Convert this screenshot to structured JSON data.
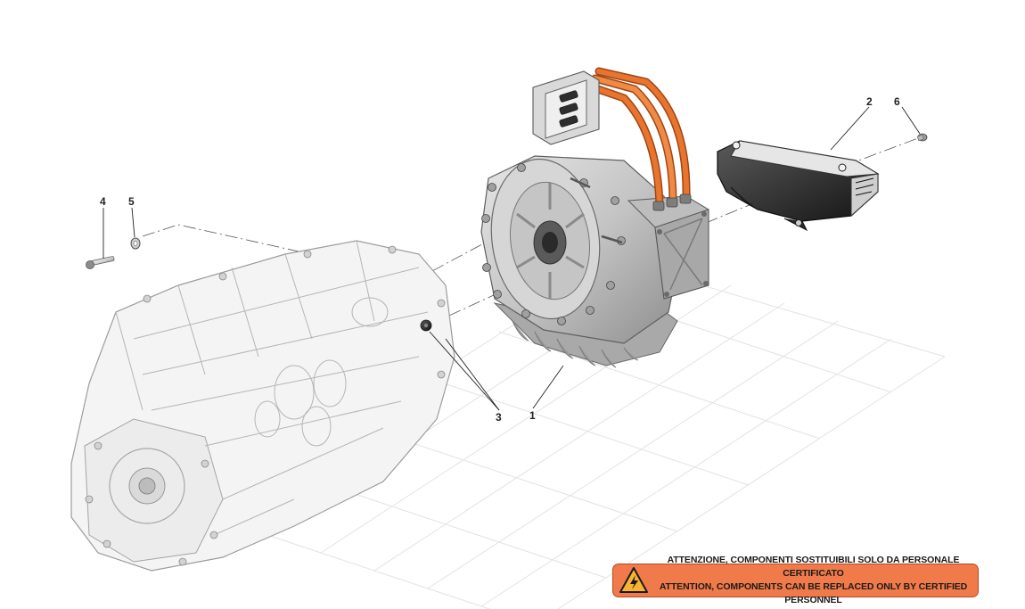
{
  "callouts": {
    "c1": "1",
    "c2": "2",
    "c3": "3",
    "c4": "4",
    "c5": "5",
    "c6": "6"
  },
  "warning": {
    "icon": "high-voltage-warning-icon",
    "line_it": "ATTENZIONE, COMPONENTI SOSTITUIBILI SOLO DA PERSONALE CERTIFICATO",
    "line_en": "ATTENTION, COMPONENTS CAN BE REPLACED ONLY BY CERTIFIED PERSONNEL"
  },
  "colors": {
    "warning_bg": "#f07a4a",
    "cable_orange": "#e8742e",
    "metal_grey": "#c9c9c9",
    "dark_part": "#2b2b2b"
  }
}
